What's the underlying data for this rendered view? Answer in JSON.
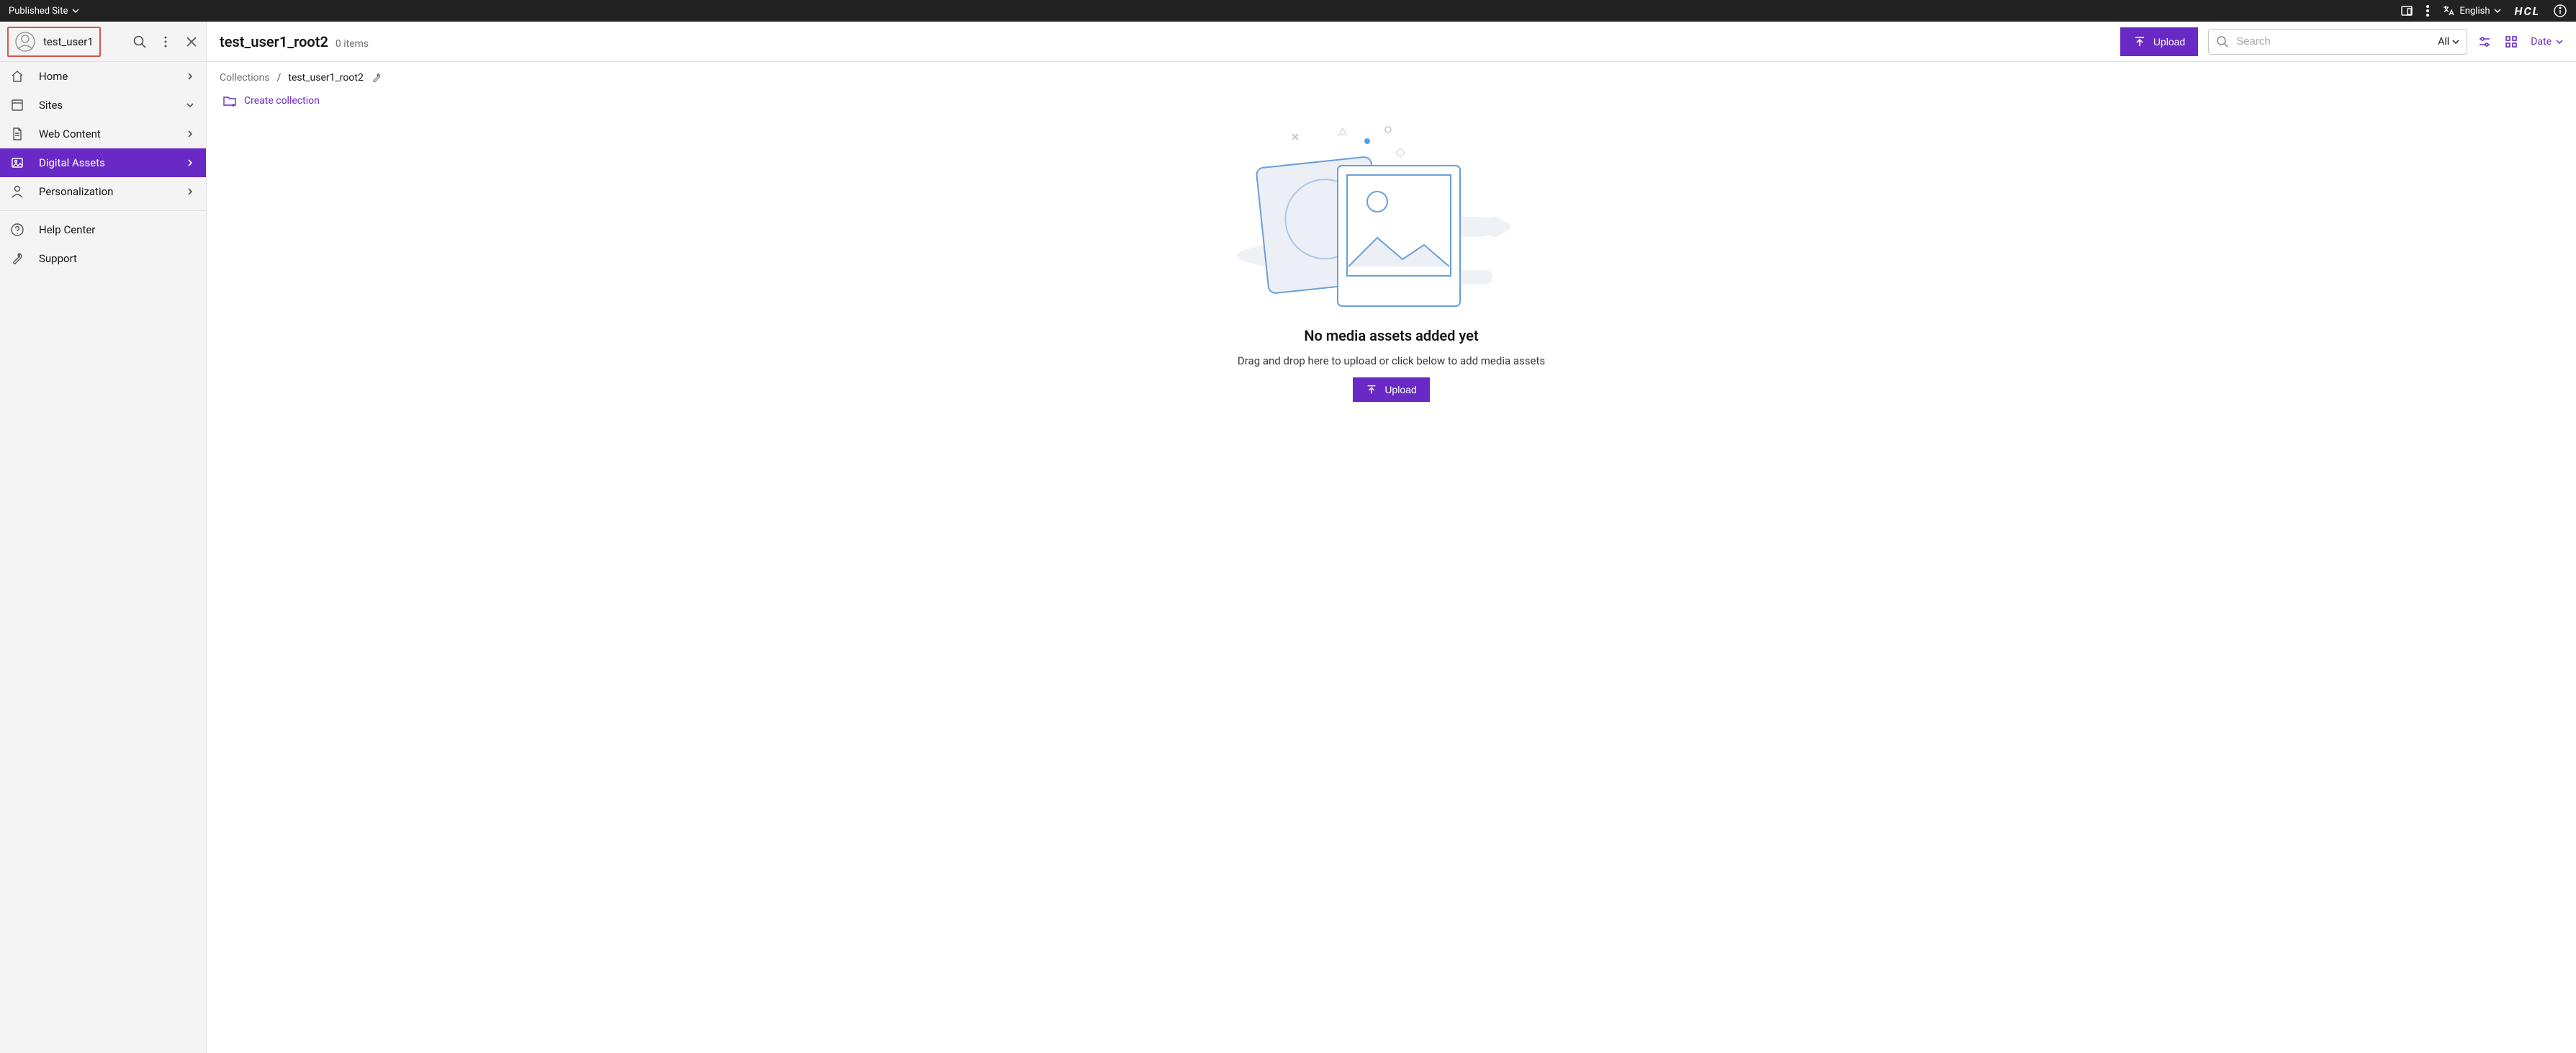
{
  "topbar": {
    "site_label": "Published Site",
    "language_label": "English",
    "logo_text": "HCL"
  },
  "sidebar": {
    "username": "test_user1",
    "nav": [
      {
        "label": "Home",
        "icon": "home",
        "chevron": "right"
      },
      {
        "label": "Sites",
        "icon": "sites",
        "chevron": "down"
      },
      {
        "label": "Web Content",
        "icon": "doc",
        "chevron": "right"
      },
      {
        "label": "Digital Assets",
        "icon": "image",
        "chevron": "right",
        "active": true
      },
      {
        "label": "Personalization",
        "icon": "person",
        "chevron": "right"
      }
    ],
    "secondary": [
      {
        "label": "Help Center",
        "icon": "help"
      },
      {
        "label": "Support",
        "icon": "wrench"
      }
    ]
  },
  "header": {
    "title": "test_user1_root2",
    "items_text": "0 items",
    "upload_label": "Upload",
    "search": {
      "placeholder": "Search",
      "filter_label": "All"
    },
    "date_label": "Date"
  },
  "breadcrumb": {
    "root_label": "Collections",
    "separator": "/",
    "current": "test_user1_root2"
  },
  "create_collection_label": "Create collection",
  "empty": {
    "title": "No media assets added yet",
    "subtitle": "Drag and drop here to upload or click below to add media assets",
    "upload_label": "Upload"
  },
  "colors": {
    "accent": "#6929c4",
    "outline_red": "#d9534f"
  }
}
